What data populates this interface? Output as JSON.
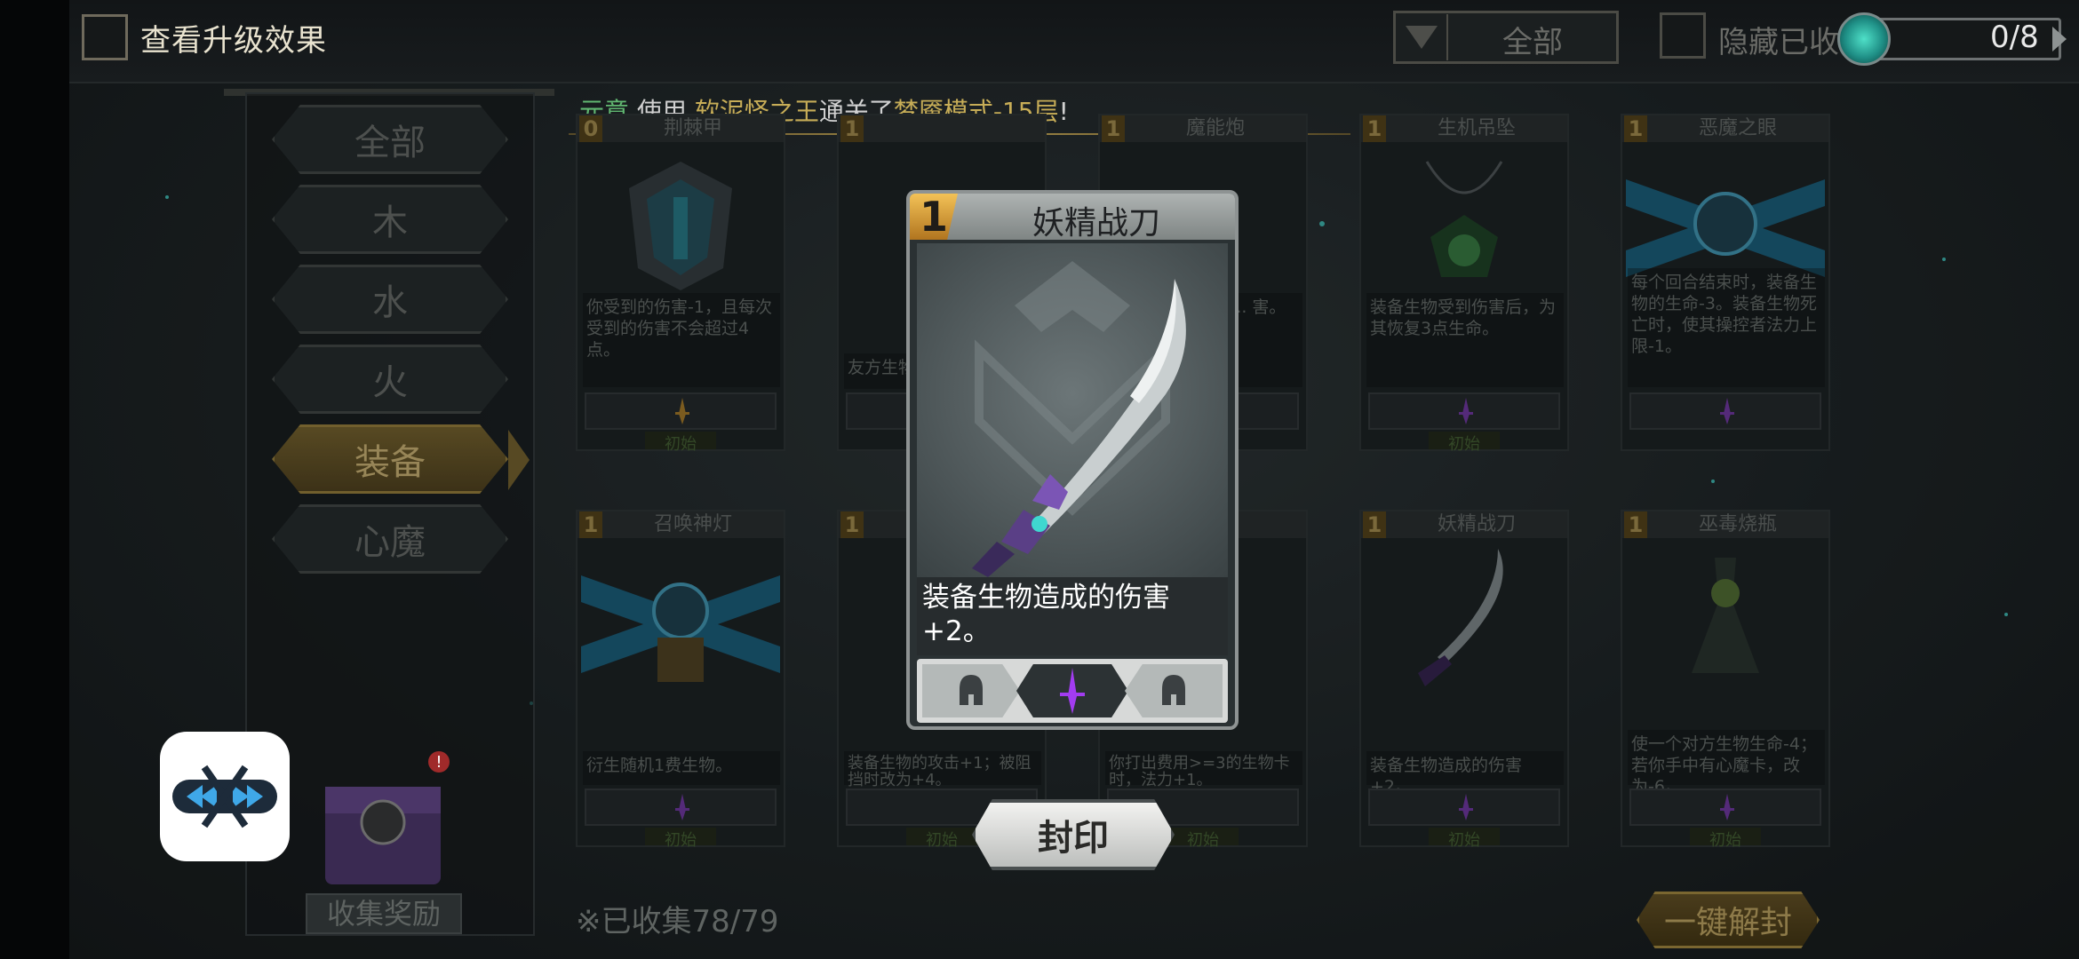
{
  "header": {
    "upgrade_label": "查看升级效果",
    "filter_label": "全部",
    "hide_label": "隐藏已收",
    "progress": "0/8"
  },
  "notice": {
    "prefix": "元意",
    "verb": " 使用 ",
    "deck": "软泥怪之王",
    "middle": "通关了",
    "mode": "梦魇模式-15层",
    "suffix": "!"
  },
  "categories": [
    {
      "label": "全部"
    },
    {
      "label": "木"
    },
    {
      "label": "水"
    },
    {
      "label": "火"
    },
    {
      "label": "装备"
    },
    {
      "label": "心魔"
    }
  ],
  "cards": [
    {
      "cost": "0",
      "name": "荆棘甲",
      "desc": "你受到的伤害-1，且每次受到的伤害不会超过4点。",
      "tag": "初始",
      "accent": "#c28a2e"
    },
    {
      "cost": "1",
      "name": "",
      "desc": "友方生物... 生命-2。",
      "tag": "",
      "accent": "#8b6a2a"
    },
    {
      "cost": "1",
      "name": "魔能炮",
      "desc": "...法卡... 同于该... 害。",
      "tag": "",
      "accent": "#7b5a2a"
    },
    {
      "cost": "1",
      "name": "生机吊坠",
      "desc": "装备生物受到伤害后，为其恢复3点生命。",
      "tag": "初始",
      "accent": "#3f8a4a"
    },
    {
      "cost": "1",
      "name": "恶魔之眼",
      "desc": "每个回合结束时，装备生物的生命-3。装备生物死亡时，使其操控者法力上限-1。",
      "tag": "",
      "accent": "#2b6e8a"
    },
    {
      "cost": "1",
      "name": "召唤神灯",
      "desc": "衍生随机1费生物。",
      "tag": "初始",
      "accent": "#2b6e8a"
    },
    {
      "cost": "1",
      "name": "",
      "desc": "装备生物的攻击+1；被阻挡时改为+4。",
      "tag": "初始",
      "accent": "#555"
    },
    {
      "cost": "1",
      "name": "...球",
      "desc": "你打出费用>=3的生物卡时，法力+1。",
      "tag": "初始",
      "accent": "#555"
    },
    {
      "cost": "1",
      "name": "妖精战刀",
      "desc": "装备生物造成的伤害+2。",
      "tag": "初始",
      "accent": "#7d5bb0"
    },
    {
      "cost": "1",
      "name": "巫毒烧瓶",
      "desc": "使一个对方生物生命-4；若你手中有心魔卡，改为-6。",
      "tag": "初始",
      "accent": "#5c7a3a"
    }
  ],
  "modal": {
    "cost": "1",
    "name": "妖精战刀",
    "desc": "装备生物造成的伤害+2。"
  },
  "buttons": {
    "seal": "封印",
    "unseal_all": "一键解封",
    "reward": "收集奖励"
  },
  "collected": "※已收集78/79",
  "colors": {
    "gold": "#f3d36b",
    "green": "#77e08a",
    "purple": "#a23cf0"
  }
}
